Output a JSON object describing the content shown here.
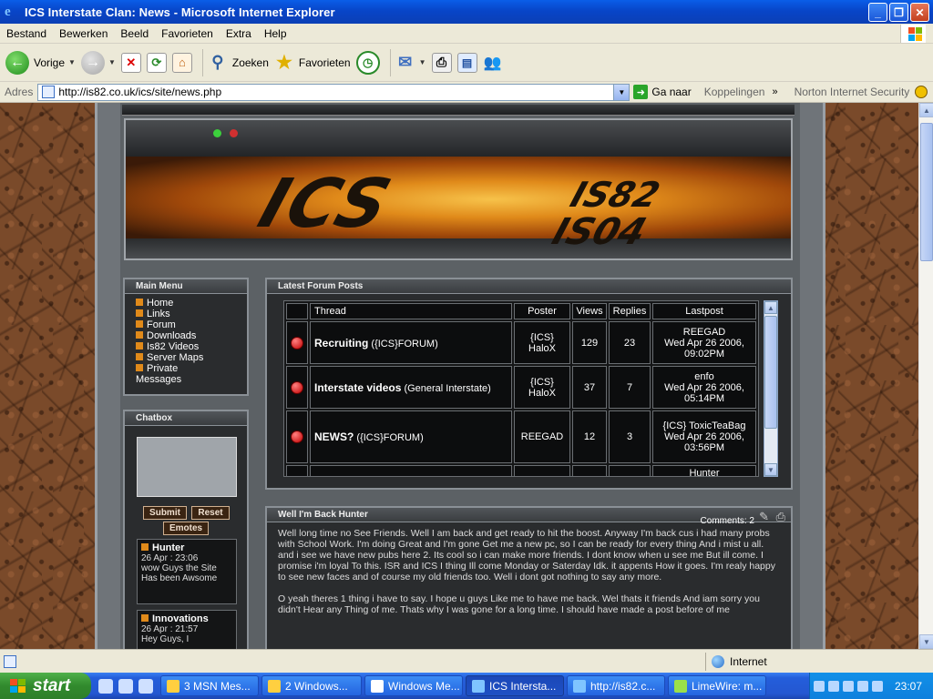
{
  "window": {
    "title": "ICS Interstate Clan: News - Microsoft Internet Explorer",
    "icon": "ie-icon"
  },
  "menubar": {
    "items": [
      "Bestand",
      "Bewerken",
      "Beeld",
      "Favorieten",
      "Extra",
      "Help"
    ]
  },
  "toolbar": {
    "back_label": "Vorige",
    "search_label": "Zoeken",
    "favorites_label": "Favorieten"
  },
  "addressbar": {
    "label": "Adres",
    "url": "http://is82.co.uk/ics/site/news.php",
    "go_label": "Ga naar",
    "links_label": "Koppelingen",
    "norton_label": "Norton Internet Security"
  },
  "site": {
    "banner_text": "ICS",
    "banner_sub1": "IS82",
    "banner_sub2": "IS04",
    "main_menu": {
      "title": "Main Menu",
      "items": [
        "Home",
        "Links",
        "Forum",
        "Downloads",
        "Is82 Videos",
        "Server Maps",
        "Private",
        "Messages"
      ]
    },
    "chatbox": {
      "title": "Chatbox",
      "submit_label": "Submit",
      "reset_label": "Reset",
      "emotes_label": "Emotes",
      "messages": [
        {
          "who": "Hunter",
          "when": "26 Apr : 23:06",
          "msg": "wow Guys the Site Has been Awsome"
        },
        {
          "who": "Innovations",
          "when": "26 Apr : 21:57",
          "msg": "Hey Guys, I"
        }
      ]
    },
    "forum": {
      "title": "Latest Forum Posts",
      "columns": [
        "Thread",
        "Poster",
        "Views",
        "Replies",
        "Lastpost"
      ],
      "rows": [
        {
          "thread": "Recruiting",
          "cat": "({ICS}FORUM)",
          "poster": "{ICS} HaloX",
          "views": "129",
          "replies": "23",
          "lp_user": "REEGAD",
          "lp_date": "Wed Apr 26 2006, 09:02PM"
        },
        {
          "thread": "Interstate videos",
          "cat": "(General Interstate)",
          "poster": "{ICS} HaloX",
          "views": "37",
          "replies": "7",
          "lp_user": "enfo",
          "lp_date": "Wed Apr 26 2006, 05:14PM"
        },
        {
          "thread": "NEWS?",
          "cat": "({ICS}FORUM)",
          "poster": "REEGAD",
          "views": "12",
          "replies": "3",
          "lp_user": "{ICS} ToxicTeaBag",
          "lp_date": "Wed Apr 26 2006, 03:56PM"
        }
      ],
      "partial_next": "Hunter"
    },
    "news": {
      "title": "Well I'm Back Hunter",
      "comments_label": "Comments: 2",
      "paragraphs": [
        "Well long time no See Friends. Well I am back and get ready to hit the boost. Anyway I'm back cus i had many probs with School Work. I'm doing Great and I'm gone Get me a new pc, so I can be ready for every thing And i mist u all. and i see we have new pubs here 2. Its cool so i can make more friends. I dont know when u see me But ill come. I promise i'm loyal To this. ISR and ICS I thing Ill come Monday or Saterday Idk. it appents How it goes. I'm realy happy to see new faces and of course my old friends too. Well i dont got nothing to say any more.",
        "O yeah theres 1 thing i have to say. I hope u guys Like me to have me back. Wel thats it friends And iam sorry you didn't Hear any Thing of me. Thats why I was gone for a long time. I should have made a post before of me"
      ]
    }
  },
  "statusbar": {
    "zone_label": "Internet"
  },
  "taskbar": {
    "start_label": "start",
    "tasks": [
      {
        "label": "3 MSN Mes...",
        "active": false
      },
      {
        "label": "2 Windows...",
        "active": false
      },
      {
        "label": "Windows Me...",
        "active": false
      },
      {
        "label": "ICS Intersta...",
        "active": true
      },
      {
        "label": "http://is82.c...",
        "active": false
      },
      {
        "label": "LimeWire: m...",
        "active": false
      }
    ],
    "clock": "23:07"
  }
}
